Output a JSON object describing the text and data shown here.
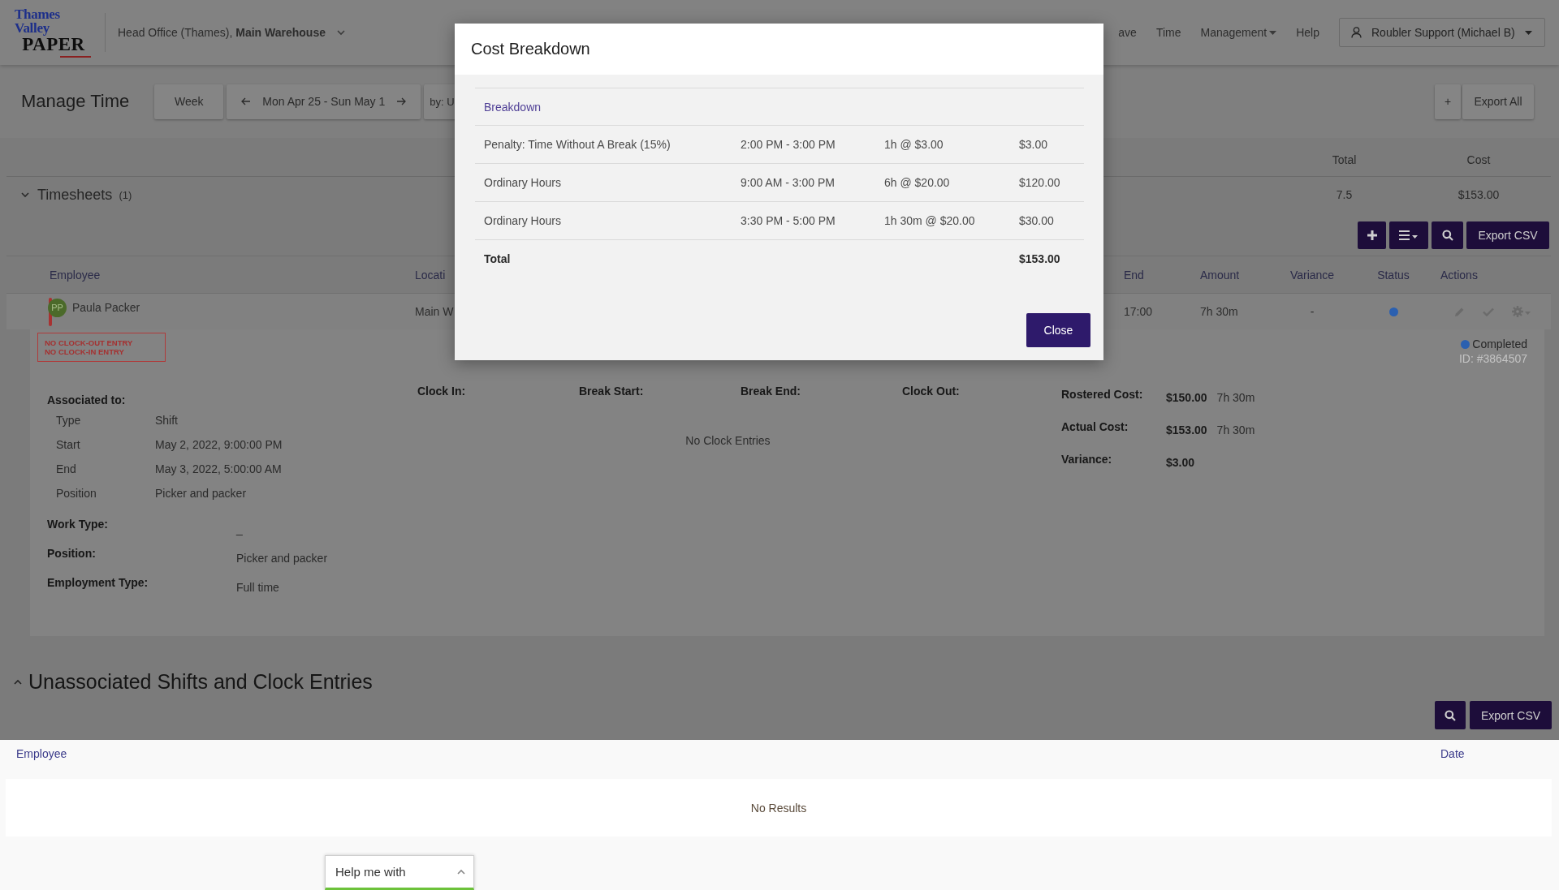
{
  "header": {
    "logo": {
      "line_1": "Thames Valley",
      "line_2": "PAPER"
    },
    "location": "Head Office (Thames), **Main Warehouse**",
    "nav": [
      {
        "label": "ave",
        "dropdown": false
      },
      {
        "label": "Time",
        "dropdown": false
      },
      {
        "label": "Management",
        "dropdown": true
      },
      {
        "label": "Help",
        "dropdown": false
      }
    ],
    "user": "Roubler Support (Michael B)"
  },
  "toolbar": {
    "title": "Manage Time",
    "period": "Week",
    "date_range": "Mon Apr 25 - Sun May 1",
    "group_by": "by: U",
    "add": "+",
    "export_all": "Export All"
  },
  "timesheets": {
    "title": "Timesheets",
    "count": "(1)",
    "summary_columns": [
      "Total",
      "Cost"
    ],
    "summary_values": [
      "7.5",
      "$153.00"
    ],
    "export": "Export CSV",
    "columns": [
      "Employee",
      "Locati",
      "End",
      "Amount",
      "Variance",
      "Status",
      "Actions"
    ],
    "rows": [
      {
        "initials": "PP",
        "employee": "Paula Packer",
        "location": "Main W",
        "end": "17:00",
        "amount": "7h 30m",
        "variance": "-",
        "color": "#2b60b0",
        "alerts": [
          "NO CLOCK-OUT ENTRY",
          "NO CLOCK-IN ENTRY"
        ],
        "status_label": "Completed",
        "record_id": "ID: #3864507",
        "associated_title": "Associated to:",
        "associated": [
          {
            "label": "Type",
            "value": "Shift"
          },
          {
            "label": "Start",
            "value": "May 2, 2022, 9:00:00 PM"
          },
          {
            "label": "End",
            "value": "May 3, 2022, 5:00:00 AM"
          },
          {
            "label": "Position",
            "value": "Picker and packer"
          }
        ],
        "attributes": [
          {
            "label": "Work Type:",
            "value": "_"
          },
          {
            "label": "Position:",
            "value": "Picker and packer"
          },
          {
            "label": "Employment Type:",
            "value": "Full time"
          }
        ],
        "clock_columns": [
          "Clock In:",
          "Break Start:",
          "Break End:",
          "Clock Out:"
        ],
        "clock_empty": "No Clock Entries",
        "costs": [
          {
            "label": "Rostered Cost:",
            "amount": "$150.00",
            "hours": "7h 30m"
          },
          {
            "label": "Actual Cost:",
            "amount": "$153.00",
            "hours": "7h 30m"
          },
          {
            "label": "Variance:",
            "amount": "$3.00"
          }
        ]
      }
    ]
  },
  "unassociated": {
    "title": "Unassociated Shifts and Clock Entries",
    "export": "Export CSV",
    "columns": [
      "Employee",
      "Date"
    ],
    "empty": "No Results"
  },
  "modal": {
    "title": "Cost Breakdown",
    "heading": "Breakdown",
    "rows": [
      {
        "description": "Penalty: Time Without A Break (15%)",
        "time": "2:00 PM - 3:00 PM",
        "rate": "1h @ $3.00",
        "amount": "$3.00"
      },
      {
        "description": "Ordinary Hours",
        "time": "9:00 AM - 3:00 PM",
        "rate": "6h @ $20.00",
        "amount": "$120.00"
      },
      {
        "description": "Ordinary Hours",
        "time": "3:30 PM - 5:00 PM",
        "rate": "1h 30m @ $20.00",
        "amount": "$30.00"
      }
    ],
    "total": {
      "label": "Total",
      "amount": "$153.00"
    },
    "close": "Close"
  },
  "help": {
    "label": "Help me with"
  }
}
